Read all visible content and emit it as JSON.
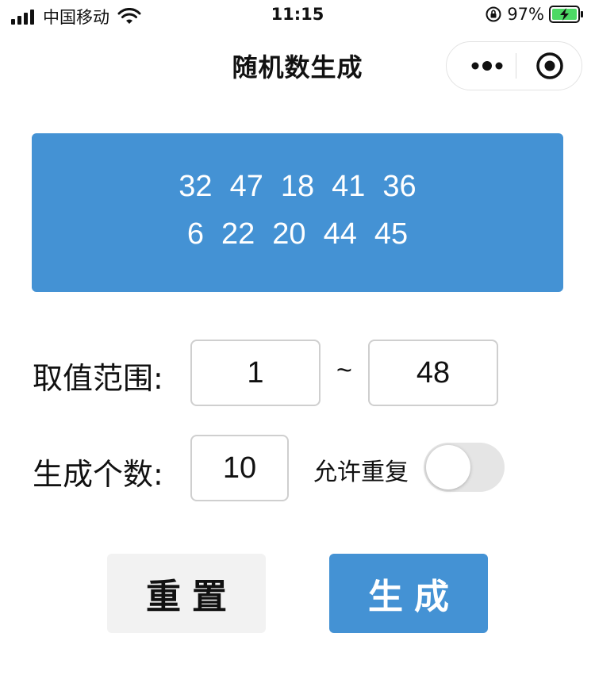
{
  "status_bar": {
    "carrier": "中国移动",
    "time": "11:15",
    "battery_percent": "97%",
    "battery_level": 0.97
  },
  "nav": {
    "title": "随机数生成"
  },
  "result": {
    "line1": [
      "32",
      "47",
      "18",
      "41",
      "36"
    ],
    "line2": [
      "6",
      "22",
      "20",
      "44",
      "45"
    ]
  },
  "range": {
    "label": "取值范围:",
    "min": "1",
    "separator": "~",
    "max": "48"
  },
  "count": {
    "label": "生成个数:",
    "value": "10"
  },
  "allow_repeat": {
    "label": "允许重复",
    "enabled": false
  },
  "buttons": {
    "reset": "重置",
    "generate": "生成"
  },
  "colors": {
    "accent": "#4492d4",
    "reset_bg": "#f2f2f2",
    "switch_off": "#e5e5e5"
  }
}
